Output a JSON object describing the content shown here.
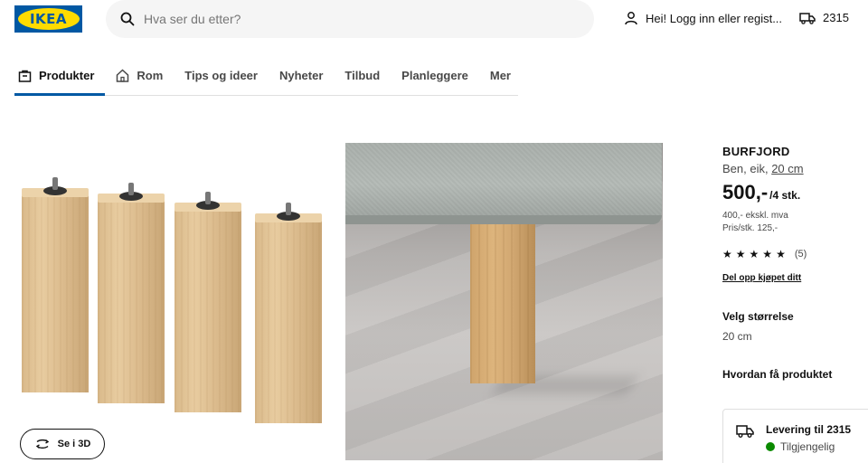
{
  "header": {
    "logo_text": "IKEA",
    "search_placeholder": "Hva ser du etter?",
    "login_label": "Hei! Logg inn eller regist...",
    "delivery_postcode": "2315"
  },
  "nav": {
    "items": [
      {
        "label": "Produkter",
        "icon": "shopping-bag-icon",
        "active": true
      },
      {
        "label": "Rom",
        "icon": "home-icon",
        "active": false
      },
      {
        "label": "Tips og ideer",
        "active": false
      },
      {
        "label": "Nyheter",
        "active": false
      },
      {
        "label": "Tilbud",
        "active": false
      },
      {
        "label": "Planleggere",
        "active": false
      },
      {
        "label": "Mer",
        "active": false
      }
    ]
  },
  "gallery": {
    "view_3d_label": "Se i 3D"
  },
  "product": {
    "name": "BURFJORD",
    "description_prefix": "Ben, eik, ",
    "description_size": "20 cm",
    "price_main": "500,-",
    "price_unit": "/4 stk.",
    "price_ex_vat": "400,- ekskl. mva",
    "price_per_unit": "Pris/stk. 125,-",
    "rating_stars": 5,
    "review_count": "(5)",
    "split_payment_link": "Del opp kjøpet ditt",
    "size_title": "Velg størrelse",
    "size_value": "20 cm",
    "how_title": "Hvordan få produktet",
    "delivery_title": "Levering til 2315",
    "delivery_status": "Tilgjengelig"
  },
  "colors": {
    "brand_blue": "#0058a3",
    "brand_yellow": "#ffdb00",
    "available_green": "#0a8a00"
  }
}
